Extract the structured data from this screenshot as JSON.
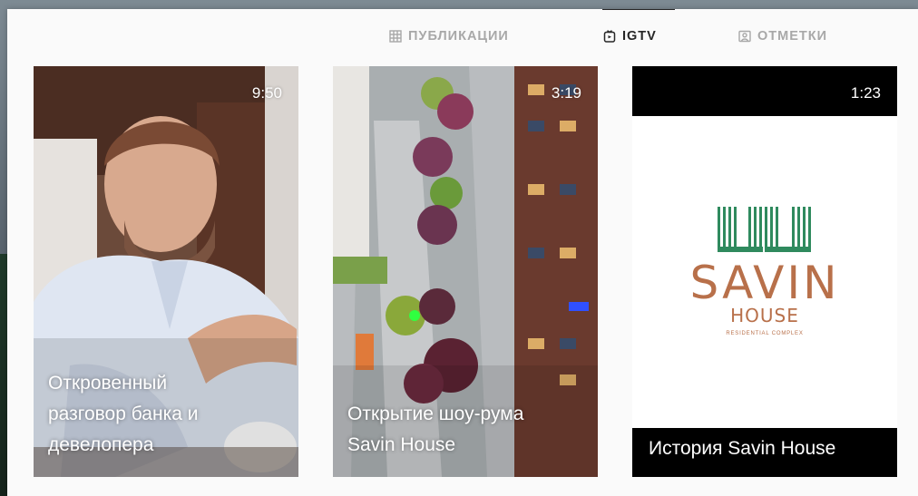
{
  "tabs": [
    {
      "label": "ПУБЛИКАЦИИ",
      "icon": "grid-icon",
      "active": false
    },
    {
      "label": "IGTV",
      "icon": "igtv-icon",
      "active": true
    },
    {
      "label": "ОТМЕТКИ",
      "icon": "tagged-icon",
      "active": false
    }
  ],
  "videos": [
    {
      "duration": "9:50",
      "title_lines": [
        "Откровенный",
        "разговор банка и",
        "девелопера"
      ]
    },
    {
      "duration": "3:19",
      "title_lines": [
        "Открытие шоу-рума",
        "Savin House"
      ]
    },
    {
      "duration": "1:23",
      "title": "История Savin House",
      "logo": {
        "name": "SAVIN",
        "sub": "HOUSE",
        "tagline": "RESIDENTIAL COMPLEX"
      }
    }
  ],
  "colors": {
    "accent_text": "#262626",
    "inactive_tab": "#a8a8a8",
    "logo": "#b8704a",
    "logo_stripes": "#2f8a5e"
  }
}
